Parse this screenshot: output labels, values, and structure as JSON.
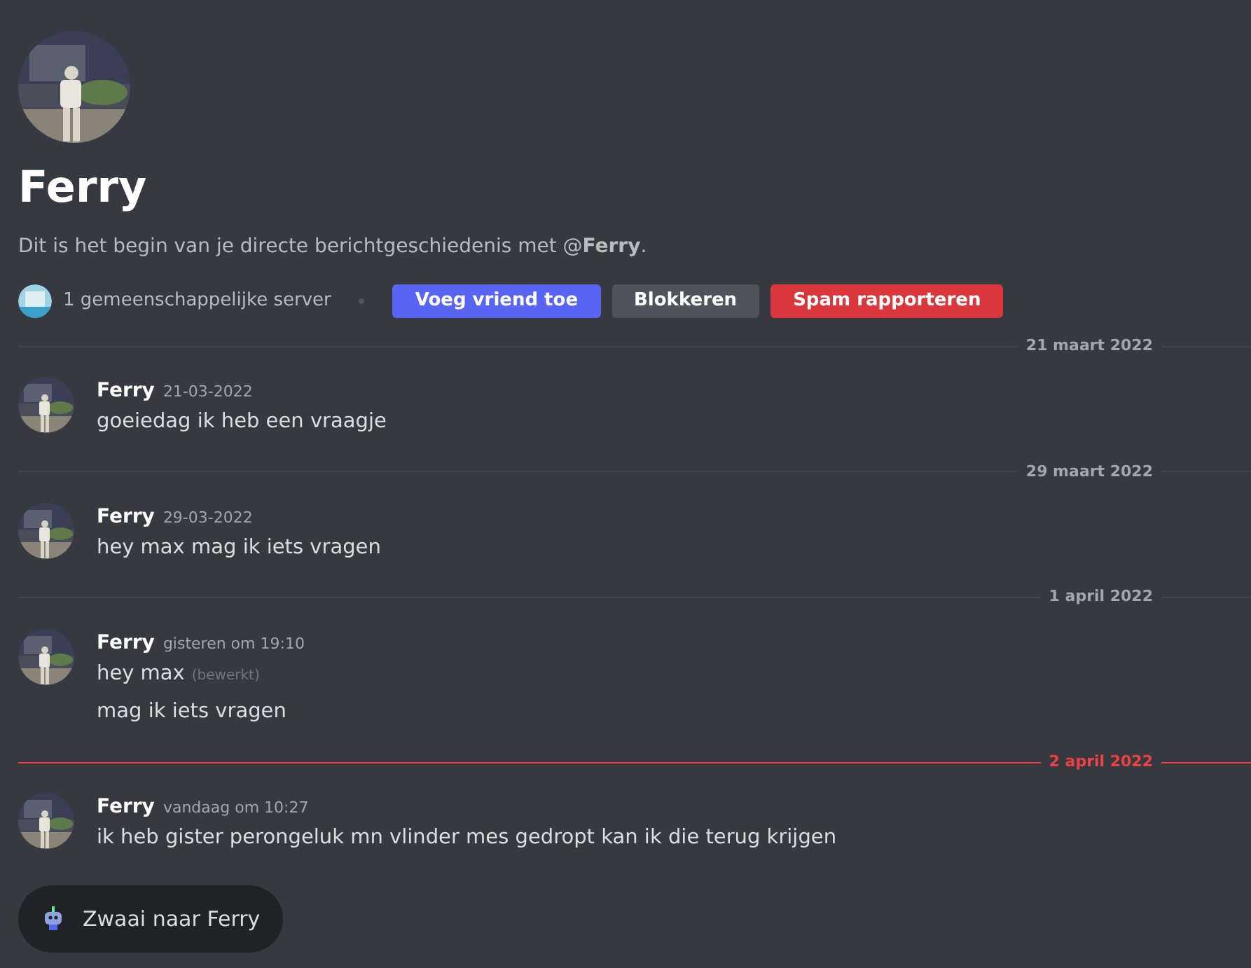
{
  "profile": {
    "kind": "picture",
    "name": "Ferry",
    "intro": "Dit is het begin van je directe berichtgeschiedenis met @**Ferry**.",
    "mutual_servers": "1 gemeenschappelijke server",
    "buttons": [
      {
        "label": "Voeg vriend toe",
        "kind": "primary"
      },
      {
        "label": "Blokkeren",
        "kind": "secondary"
      },
      {
        "label": "Spam rapporteren",
        "kind": "danger"
      }
    ]
  },
  "days": [
    {
      "date": "21 maart 2022",
      "new": false,
      "messages": [
        {
          "author": "Ferry",
          "time": "21-03-2022",
          "lines": [
            {
              "text": "goeiedag ik heb een vraagje"
            }
          ]
        }
      ]
    },
    {
      "date": "29 maart 2022",
      "new": false,
      "messages": [
        {
          "author": "Ferry",
          "time": "29-03-2022",
          "lines": [
            {
              "text": "hey max mag ik iets vragen"
            }
          ]
        }
      ]
    },
    {
      "date": "1 april 2022",
      "new": false,
      "messages": [
        {
          "author": "Ferry",
          "time": "gisteren om 19:10",
          "lines": [
            {
              "text": "hey max",
              "edited": "(bewerkt)"
            },
            {
              "text": "mag ik iets vragen"
            }
          ]
        }
      ]
    },
    {
      "date": "2 april 2022",
      "new": true,
      "messages": [
        {
          "author": "Ferry",
          "time": "vandaag om 10:27",
          "lines": [
            {
              "text": "ik heb gister perongeluk mn vlinder mes gedropt kan ik die terug krijgen"
            }
          ]
        }
      ]
    }
  ],
  "wave_button": {
    "label": "Zwaai naar Ferry"
  }
}
